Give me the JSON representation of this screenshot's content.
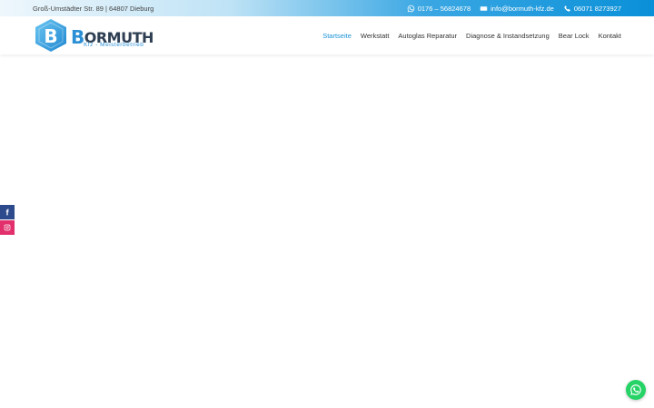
{
  "topbar": {
    "address": "Groß-Umstädter Str. 89 | 64807 Dieburg",
    "whatsapp_phone": "0176 – 56824678",
    "email": "info@bormuth-kfz.de",
    "phone": "06071 8273927"
  },
  "logo": {
    "letter": "B",
    "name_first": "B",
    "name_rest": "ORMUTH",
    "tagline": "Kfz - Meisterbetrieb"
  },
  "nav": {
    "items": [
      {
        "label": "Startseite",
        "active": true
      },
      {
        "label": "Werkstatt",
        "active": false
      },
      {
        "label": "Autoglas Reparatur",
        "active": false
      },
      {
        "label": "Diagnose & Instandsetzung",
        "active": false
      },
      {
        "label": "Bear Lock",
        "active": false
      },
      {
        "label": "Kontakt",
        "active": false
      }
    ]
  },
  "social": {
    "facebook_icon": "facebook-icon",
    "instagram_icon": "instagram-icon"
  },
  "floating": {
    "whatsapp_icon": "whatsapp-icon"
  },
  "colors": {
    "accent": "#1a92d8",
    "topbar_end": "#0a90d8",
    "facebook": "#2c4a8c",
    "instagram": "#e2306c",
    "whatsapp": "#25d366",
    "logo_dark": "#2e3e52"
  }
}
